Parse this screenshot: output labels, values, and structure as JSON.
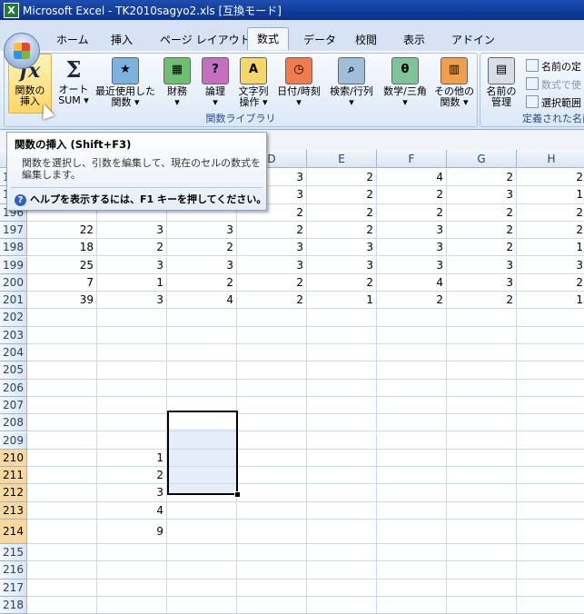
{
  "window": {
    "title": "Microsoft Excel - TK2010sagyo2.xls [互換モード]"
  },
  "tabs": [
    "ホーム",
    "挿入",
    "ページ レイアウト",
    "数式",
    "データ",
    "校閲",
    "表示",
    "アドイン"
  ],
  "active_tab": "数式",
  "ribbon": {
    "function_library": {
      "title": "関数ライブラリ",
      "insert_function": "関数の\n挿入",
      "autosum": "オート\nSUM ▾",
      "recent": "最近使用した\n関数 ▾",
      "financial": "財務\n▾",
      "logical": "論理\n▾",
      "text": "文字列\n操作 ▾",
      "datetime": "日付/時刻\n▾",
      "lookup": "検索/行列\n▾",
      "math": "数学/三角\n▾",
      "more": "その他の\n関数 ▾"
    },
    "defined_names": {
      "title": "定義された名前",
      "name_manager": "名前の\n管理",
      "define_name": "名前の定",
      "use_in_formula": "数式で使",
      "create_from_selection": "選択範囲"
    }
  },
  "tooltip": {
    "title": "関数の挿入 (Shift+F3)",
    "description": "関数を選択し、引数を編集して、現在のセルの数式を編集します。",
    "help": "ヘルプを表示するには、F1 キーを押してください。"
  },
  "columns": [
    "A",
    "B",
    "C",
    "D",
    "E",
    "F",
    "G",
    "H"
  ],
  "rows": [
    {
      "num": "194",
      "cells": [
        "",
        "",
        "",
        "3",
        "2",
        "4",
        "2",
        "2"
      ]
    },
    {
      "num": "195",
      "cells": [
        "",
        "",
        "",
        "3",
        "2",
        "2",
        "3",
        "1"
      ]
    },
    {
      "num": "196",
      "cells": [
        "",
        "",
        "",
        "2",
        "2",
        "2",
        "2",
        "2"
      ]
    },
    {
      "num": "197",
      "cells": [
        "22",
        "3",
        "3",
        "2",
        "2",
        "3",
        "2",
        "2"
      ]
    },
    {
      "num": "198",
      "cells": [
        "18",
        "2",
        "2",
        "3",
        "3",
        "3",
        "2",
        "1"
      ]
    },
    {
      "num": "199",
      "cells": [
        "25",
        "3",
        "3",
        "3",
        "3",
        "3",
        "3",
        "3"
      ]
    },
    {
      "num": "200",
      "cells": [
        "7",
        "1",
        "2",
        "2",
        "2",
        "4",
        "3",
        "2"
      ]
    },
    {
      "num": "201",
      "cells": [
        "39",
        "3",
        "4",
        "2",
        "1",
        "2",
        "2",
        "1"
      ]
    },
    {
      "num": "202",
      "cells": [
        "",
        "",
        "",
        "",
        "",
        "",
        "",
        ""
      ]
    },
    {
      "num": "203",
      "cells": [
        "",
        "",
        "",
        "",
        "",
        "",
        "",
        ""
      ]
    },
    {
      "num": "204",
      "cells": [
        "",
        "",
        "",
        "",
        "",
        "",
        "",
        ""
      ]
    },
    {
      "num": "205",
      "cells": [
        "",
        "",
        "",
        "",
        "",
        "",
        "",
        ""
      ]
    },
    {
      "num": "206",
      "cells": [
        "",
        "",
        "",
        "",
        "",
        "",
        "",
        ""
      ]
    },
    {
      "num": "207",
      "cells": [
        "",
        "",
        "",
        "",
        "",
        "",
        "",
        ""
      ]
    },
    {
      "num": "208",
      "cells": [
        "",
        "",
        "",
        "",
        "",
        "",
        "",
        ""
      ]
    },
    {
      "num": "209",
      "cells": [
        "",
        "",
        "",
        "",
        "",
        "",
        "",
        ""
      ]
    },
    {
      "num": "210",
      "cells": [
        "",
        "1",
        "",
        "",
        "",
        "",
        "",
        ""
      ]
    },
    {
      "num": "211",
      "cells": [
        "",
        "2",
        "",
        "",
        "",
        "",
        "",
        ""
      ]
    },
    {
      "num": "212",
      "cells": [
        "",
        "3",
        "",
        "",
        "",
        "",
        "",
        ""
      ]
    },
    {
      "num": "213",
      "cells": [
        "",
        "4",
        "",
        "",
        "",
        "",
        "",
        ""
      ]
    },
    {
      "num": "214",
      "cells": [
        "",
        "9",
        "",
        "",
        "",
        "",
        "",
        ""
      ]
    },
    {
      "num": "215",
      "cells": [
        "",
        "",
        "",
        "",
        "",
        "",
        "",
        ""
      ]
    },
    {
      "num": "216",
      "cells": [
        "",
        "",
        "",
        "",
        "",
        "",
        "",
        ""
      ]
    },
    {
      "num": "217",
      "cells": [
        "",
        "",
        "",
        "",
        "",
        "",
        "",
        ""
      ]
    },
    {
      "num": "218",
      "cells": [
        "",
        "",
        "",
        "",
        "",
        "",
        "",
        ""
      ]
    }
  ],
  "selected_rows": [
    "210",
    "211",
    "212",
    "213",
    "214"
  ]
}
